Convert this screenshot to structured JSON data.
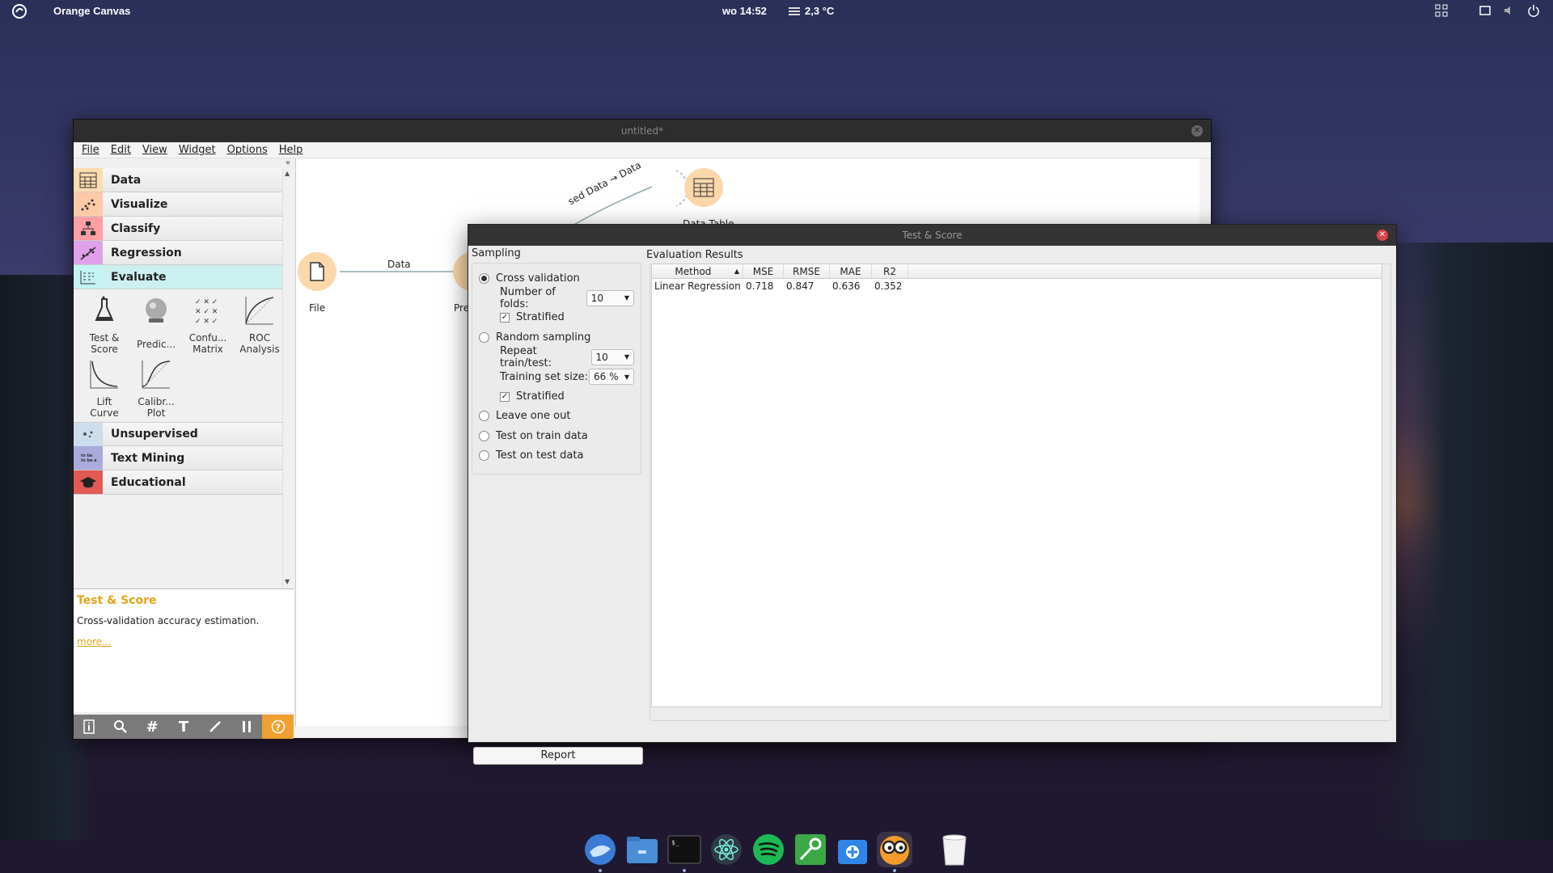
{
  "topbar": {
    "app_name": "Orange Canvas",
    "clock": "wo 14:52",
    "weather": "2,3 °C"
  },
  "main_window": {
    "title": "untitled*",
    "menu": [
      "File",
      "Edit",
      "View",
      "Widget",
      "Options",
      "Help"
    ]
  },
  "toolbox": {
    "categories": [
      {
        "label": "Data",
        "icon": "table-icon",
        "color": "#fddcb0"
      },
      {
        "label": "Visualize",
        "icon": "scatter-icon",
        "color": "#ffc9a8"
      },
      {
        "label": "Classify",
        "icon": "tree-icon",
        "color": "#ff9ea5"
      },
      {
        "label": "Regression",
        "icon": "regression-icon",
        "color": "#e0a0ea"
      },
      {
        "label": "Evaluate",
        "icon": "evaluate-icon",
        "color": "#c3f3f3"
      }
    ],
    "evaluate_widgets": [
      {
        "label": "Test &\nScore",
        "icon": "flask-icon"
      },
      {
        "label": "Predic...",
        "icon": "crystal-ball-icon"
      },
      {
        "label": "Confu...\nMatrix",
        "icon": "matrix-icon"
      },
      {
        "label": "ROC\nAnalysis",
        "icon": "roc-icon"
      },
      {
        "label": "Lift\nCurve",
        "icon": "lift-curve-icon"
      },
      {
        "label": "Calibr...\nPlot",
        "icon": "calibration-icon"
      }
    ],
    "more_categories": [
      {
        "label": "Unsupervised",
        "icon": "unsupervised-icon",
        "color": "#cde"
      },
      {
        "label": "Text Mining",
        "icon": "text-mining-icon",
        "color": "#aad"
      },
      {
        "label": "Educational",
        "icon": "graduation-cap-icon",
        "color": "#e25a54"
      }
    ]
  },
  "help_panel": {
    "title": "Test & Score",
    "description": "Cross-validation accuracy estimation.",
    "more": "more..."
  },
  "canvas": {
    "nodes": [
      {
        "label": "File"
      },
      {
        "label": "Pre"
      },
      {
        "label": "Data Table"
      }
    ],
    "links": [
      "Data",
      "sed Data → Data"
    ]
  },
  "dialog": {
    "title": "Test & Score",
    "sampling_title": "Sampling",
    "cross_validation": "Cross validation",
    "folds_label": "Number of folds:",
    "folds_value": "10",
    "stratified": "Stratified",
    "random_sampling": "Random sampling",
    "repeat_label": "Repeat train/test:",
    "repeat_value": "10",
    "training_label": "Training set size:",
    "training_value": "66 %",
    "stratified2": "Stratified",
    "leave_one_out": "Leave one out",
    "train_data": "Test on train data",
    "test_data": "Test on test data",
    "report": "Report",
    "results_title": "Evaluation Results",
    "columns": [
      "Method",
      "MSE",
      "RMSE",
      "MAE",
      "R2"
    ],
    "rows": [
      [
        "Linear Regression",
        "0.718",
        "0.847",
        "0.636",
        "0.352"
      ]
    ]
  },
  "dock": [
    "browser-icon",
    "files-icon",
    "terminal-icon",
    "atom-icon",
    "spotify-icon",
    "passwords-icon",
    "appcenter-icon",
    "orange-icon",
    "trash-icon"
  ]
}
